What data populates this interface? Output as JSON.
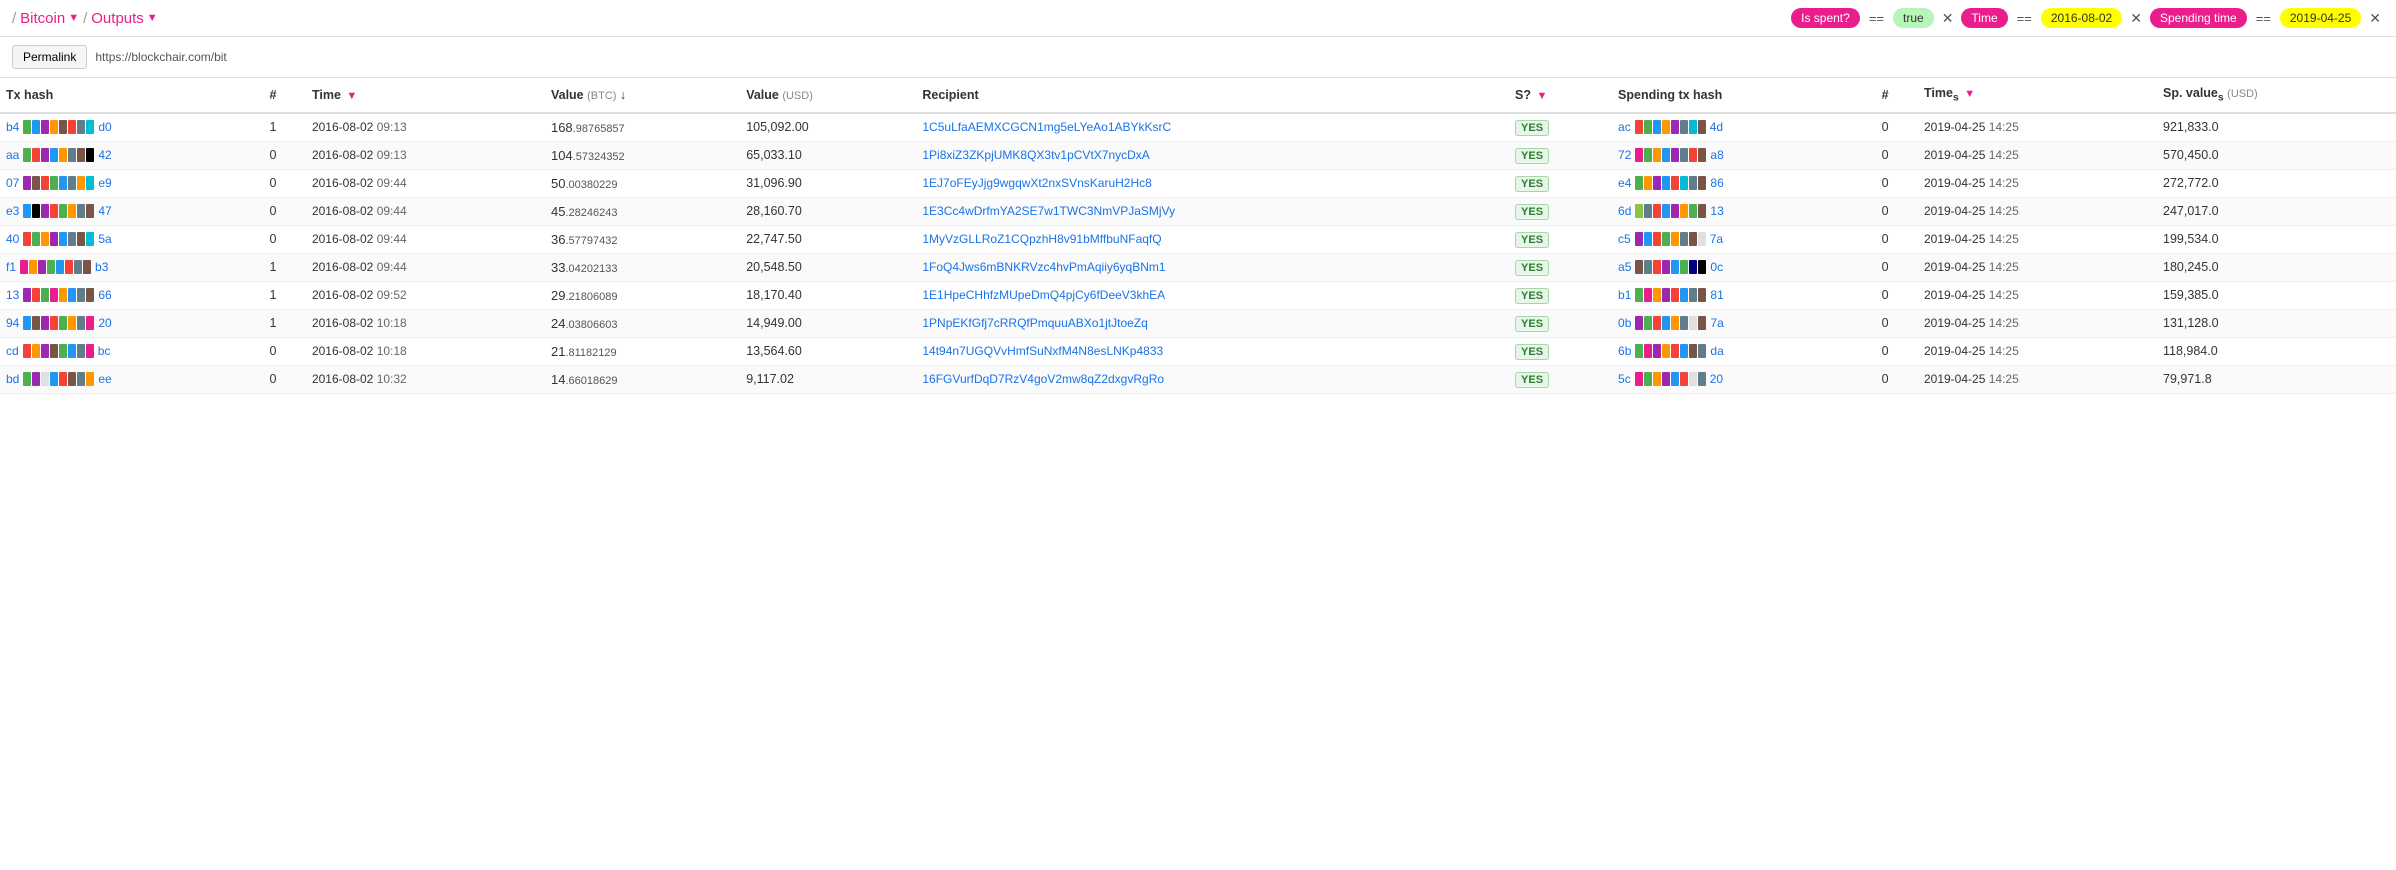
{
  "header": {
    "breadcrumb": [
      {
        "label": "Bitcoin",
        "has_dropdown": true
      },
      {
        "label": "Outputs",
        "has_dropdown": true
      }
    ],
    "filters": [
      {
        "tag": "Is spent?",
        "op": "==",
        "val": "true",
        "val_color": "green"
      },
      {
        "tag": "Time",
        "op": "==",
        "val": "2016-08-02",
        "val_color": "yellow"
      },
      {
        "tag": "Spending time",
        "op": "==",
        "val": "2019-04-25",
        "val_color": "yellow"
      }
    ]
  },
  "permalink": {
    "button": "Permalink",
    "url": "https://blockchair.com/bit"
  },
  "table": {
    "columns": [
      {
        "id": "tx_hash",
        "label": "Tx hash"
      },
      {
        "id": "num",
        "label": "#"
      },
      {
        "id": "time",
        "label": "Time",
        "filter": true
      },
      {
        "id": "value_btc",
        "label": "Value",
        "unit": "(BTC)",
        "sort": true
      },
      {
        "id": "value_usd",
        "label": "Value",
        "unit": "(USD)"
      },
      {
        "id": "recipient",
        "label": "Recipient"
      },
      {
        "id": "spent",
        "label": "S?",
        "filter": true
      },
      {
        "id": "spending_tx",
        "label": "Spending tx hash"
      },
      {
        "id": "sp_num",
        "label": "#"
      },
      {
        "id": "times",
        "label": "Times",
        "filter": true
      },
      {
        "id": "sp_value",
        "label": "Sp. value",
        "unit": "s (USD)"
      }
    ],
    "rows": [
      {
        "tx_hash_prefix": "b4",
        "tx_hash_colors": [
          "#4caf50",
          "#2196f3",
          "#9c27b0",
          "#ff9800",
          "#795548",
          "#f44336",
          "#607d8b",
          "#00bcd4"
        ],
        "tx_hash_suffix": "d0",
        "num": "1",
        "time_date": "2016-08-02",
        "time_time": "09:13",
        "value_btc_main": "168",
        "value_btc_sub": ".98765857",
        "value_usd": "105,092.00",
        "recipient": "1C5uLfaAEMXCGCN1mg5eLYeAo1ABYkKsrC",
        "spent": "YES",
        "sp_hash_prefix": "ac",
        "sp_hash_colors": [
          "#f44336",
          "#4caf50",
          "#2196f3",
          "#ff9800",
          "#9c27b0",
          "#607d8b",
          "#00bcd4",
          "#795548"
        ],
        "sp_hash_suffix": "4d",
        "sp_num": "0",
        "sp_time_date": "2019-04-25",
        "sp_time_time": "14:25",
        "sp_value": "921,833.0"
      },
      {
        "tx_hash_prefix": "aa",
        "tx_hash_colors": [
          "#4caf50",
          "#f44336",
          "#9c27b0",
          "#2196f3",
          "#ff9800",
          "#607d8b",
          "#795548",
          "#000000"
        ],
        "tx_hash_suffix": "42",
        "num": "0",
        "time_date": "2016-08-02",
        "time_time": "09:13",
        "value_btc_main": "104",
        "value_btc_sub": ".57324352",
        "value_usd": "65,033.10",
        "recipient": "1Pi8xiZ3ZKpjUMK8QX3tv1pCVtX7nycDxA",
        "spent": "YES",
        "sp_hash_prefix": "72",
        "sp_hash_colors": [
          "#e91e8c",
          "#4caf50",
          "#ff9800",
          "#2196f3",
          "#9c27b0",
          "#607d8b",
          "#f44336",
          "#795548"
        ],
        "sp_hash_suffix": "a8",
        "sp_num": "0",
        "sp_time_date": "2019-04-25",
        "sp_time_time": "14:25",
        "sp_value": "570,450.0"
      },
      {
        "tx_hash_prefix": "07",
        "tx_hash_colors": [
          "#9c27b0",
          "#795548",
          "#f44336",
          "#4caf50",
          "#2196f3",
          "#607d8b",
          "#ff9800",
          "#00bcd4"
        ],
        "tx_hash_suffix": "e9",
        "num": "0",
        "time_date": "2016-08-02",
        "time_time": "09:44",
        "value_btc_main": "50",
        "value_btc_sub": ".00380229",
        "value_usd": "31,096.90",
        "recipient": "1EJ7oFEyJjg9wgqwXt2nxSVnsKaruH2Hc8",
        "spent": "YES",
        "sp_hash_prefix": "e4",
        "sp_hash_colors": [
          "#4caf50",
          "#ff9800",
          "#9c27b0",
          "#2196f3",
          "#f44336",
          "#00bcd4",
          "#607d8b",
          "#795548"
        ],
        "sp_hash_suffix": "86",
        "sp_num": "0",
        "sp_time_date": "2019-04-25",
        "sp_time_time": "14:25",
        "sp_value": "272,772.0"
      },
      {
        "tx_hash_prefix": "e3",
        "tx_hash_colors": [
          "#2196f3",
          "#000000",
          "#9c27b0",
          "#f44336",
          "#4caf50",
          "#ff9800",
          "#607d8b",
          "#795548"
        ],
        "tx_hash_suffix": "47",
        "num": "0",
        "time_date": "2016-08-02",
        "time_time": "09:44",
        "value_btc_main": "45",
        "value_btc_sub": ".28246243",
        "value_usd": "28,160.70",
        "recipient": "1E3Cc4wDrfmYA2SE7w1TWC3NmVPJaSMjVy",
        "spent": "YES",
        "sp_hash_prefix": "6d",
        "sp_hash_colors": [
          "#8bc34a",
          "#607d8b",
          "#f44336",
          "#2196f3",
          "#9c27b0",
          "#ff9800",
          "#4caf50",
          "#795548"
        ],
        "sp_hash_suffix": "13",
        "sp_num": "0",
        "sp_time_date": "2019-04-25",
        "sp_time_time": "14:25",
        "sp_value": "247,017.0"
      },
      {
        "tx_hash_prefix": "40",
        "tx_hash_colors": [
          "#f44336",
          "#4caf50",
          "#ff9800",
          "#9c27b0",
          "#2196f3",
          "#607d8b",
          "#795548",
          "#00bcd4"
        ],
        "tx_hash_suffix": "5a",
        "num": "0",
        "time_date": "2016-08-02",
        "time_time": "09:44",
        "value_btc_main": "36",
        "value_btc_sub": ".57797432",
        "value_usd": "22,747.50",
        "recipient": "1MyVzGLLRoZ1CQpzhH8v91bMffbuNFaqfQ",
        "spent": "YES",
        "sp_hash_prefix": "c5",
        "sp_hash_colors": [
          "#9c27b0",
          "#2196f3",
          "#f44336",
          "#4caf50",
          "#ff9800",
          "#607d8b",
          "#795548",
          "#e0e0e0"
        ],
        "sp_hash_suffix": "7a",
        "sp_num": "0",
        "sp_time_date": "2019-04-25",
        "sp_time_time": "14:25",
        "sp_value": "199,534.0"
      },
      {
        "tx_hash_prefix": "f1",
        "tx_hash_colors": [
          "#e91e8c",
          "#ff9800",
          "#9c27b0",
          "#4caf50",
          "#2196f3",
          "#f44336",
          "#607d8b",
          "#795548"
        ],
        "tx_hash_suffix": "b3",
        "num": "1",
        "time_date": "2016-08-02",
        "time_time": "09:44",
        "value_btc_main": "33",
        "value_btc_sub": ".04202133",
        "value_usd": "20,548.50",
        "recipient": "1FoQ4Jws6mBNKRVzc4hvPmAqiiy6yqBNm1",
        "spent": "YES",
        "sp_hash_prefix": "a5",
        "sp_hash_colors": [
          "#795548",
          "#607d8b",
          "#f44336",
          "#9c27b0",
          "#2196f3",
          "#4caf50",
          "#000080",
          "#000000"
        ],
        "sp_hash_suffix": "0c",
        "sp_num": "0",
        "sp_time_date": "2019-04-25",
        "sp_time_time": "14:25",
        "sp_value": "180,245.0"
      },
      {
        "tx_hash_prefix": "13",
        "tx_hash_colors": [
          "#9c27b0",
          "#f44336",
          "#4caf50",
          "#e91e8c",
          "#ff9800",
          "#2196f3",
          "#607d8b",
          "#795548"
        ],
        "tx_hash_suffix": "66",
        "num": "1",
        "time_date": "2016-08-02",
        "time_time": "09:52",
        "value_btc_main": "29",
        "value_btc_sub": ".21806089",
        "value_usd": "18,170.40",
        "recipient": "1E1HpeCHhfzMUpeDmQ4pjCy6fDeeV3khEA",
        "spent": "YES",
        "sp_hash_prefix": "b1",
        "sp_hash_colors": [
          "#4caf50",
          "#e91e8c",
          "#ff9800",
          "#9c27b0",
          "#f44336",
          "#2196f3",
          "#607d8b",
          "#795548"
        ],
        "sp_hash_suffix": "81",
        "sp_num": "0",
        "sp_time_date": "2019-04-25",
        "sp_time_time": "14:25",
        "sp_value": "159,385.0"
      },
      {
        "tx_hash_prefix": "94",
        "tx_hash_colors": [
          "#2196f3",
          "#795548",
          "#9c27b0",
          "#f44336",
          "#4caf50",
          "#ff9800",
          "#607d8b",
          "#e91e8c"
        ],
        "tx_hash_suffix": "20",
        "num": "1",
        "time_date": "2016-08-02",
        "time_time": "10:18",
        "value_btc_main": "24",
        "value_btc_sub": ".03806603",
        "value_usd": "14,949.00",
        "recipient": "1PNpEKfGfj7cRRQfPmquuABXo1jtJtoeZq",
        "spent": "YES",
        "sp_hash_prefix": "0b",
        "sp_hash_colors": [
          "#9c27b0",
          "#4caf50",
          "#f44336",
          "#2196f3",
          "#ff9800",
          "#607d8b",
          "#e0e0e0",
          "#795548"
        ],
        "sp_hash_suffix": "7a",
        "sp_num": "0",
        "sp_time_date": "2019-04-25",
        "sp_time_time": "14:25",
        "sp_value": "131,128.0"
      },
      {
        "tx_hash_prefix": "cd",
        "tx_hash_colors": [
          "#f44336",
          "#ff9800",
          "#9c27b0",
          "#795548",
          "#4caf50",
          "#2196f3",
          "#607d8b",
          "#e91e8c"
        ],
        "tx_hash_suffix": "bc",
        "num": "0",
        "time_date": "2016-08-02",
        "time_time": "10:18",
        "value_btc_main": "21",
        "value_btc_sub": ".81182129",
        "value_usd": "13,564.60",
        "recipient": "14t94n7UGQVvHmfSuNxfM4N8esLNKp4833",
        "spent": "YES",
        "sp_hash_prefix": "6b",
        "sp_hash_colors": [
          "#4caf50",
          "#e91e8c",
          "#9c27b0",
          "#ff9800",
          "#f44336",
          "#2196f3",
          "#795548",
          "#607d8b"
        ],
        "sp_hash_suffix": "da",
        "sp_num": "0",
        "sp_time_date": "2019-04-25",
        "sp_time_time": "14:25",
        "sp_value": "118,984.0"
      },
      {
        "tx_hash_prefix": "bd",
        "tx_hash_colors": [
          "#4caf50",
          "#9c27b0",
          "#e0e0e0",
          "#2196f3",
          "#f44336",
          "#795548",
          "#607d8b",
          "#ff9800"
        ],
        "tx_hash_suffix": "ee",
        "num": "0",
        "time_date": "2016-08-02",
        "time_time": "10:32",
        "value_btc_main": "14",
        "value_btc_sub": ".66018629",
        "value_usd": "9,117.02",
        "recipient": "16FGVurfDqD7RzV4goV2mw8qZ2dxgvRgRo",
        "spent": "YES",
        "sp_hash_prefix": "5c",
        "sp_hash_colors": [
          "#e91e8c",
          "#4caf50",
          "#ff9800",
          "#9c27b0",
          "#2196f3",
          "#f44336",
          "#e0e0e0",
          "#607d8b"
        ],
        "sp_hash_suffix": "20",
        "sp_num": "0",
        "sp_time_date": "2019-04-25",
        "sp_time_time": "14:25",
        "sp_value": "79,971.8"
      }
    ]
  }
}
